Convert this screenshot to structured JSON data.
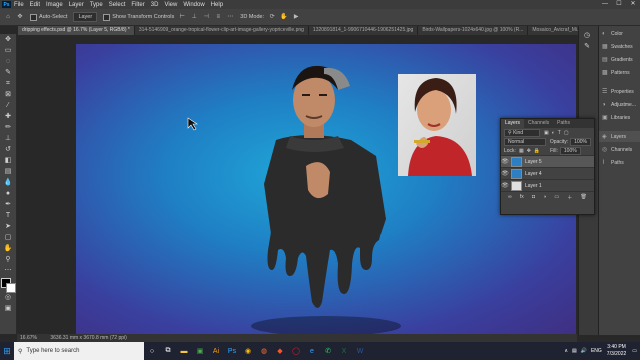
{
  "menubar": {
    "app_logo": "Ps",
    "items": [
      "File",
      "Edit",
      "Image",
      "Layer",
      "Type",
      "Select",
      "Filter",
      "3D",
      "View",
      "Window",
      "Help"
    ],
    "minimize": "—",
    "maximize": "☐",
    "close": "✕"
  },
  "options": {
    "auto_select_label": "Auto-Select",
    "auto_select_target": "Layer",
    "transform_controls_label": "Show Transform Controls",
    "mode_3d_label": "3D Mode:"
  },
  "tabs": [
    {
      "label": "dripping effects.psd @ 16.7% (Layer 5, RGB/8) *",
      "active": true
    },
    {
      "label": "314-5146909_orange-tropical-flower-clip-art-image-gallery-yopriceville.png",
      "active": false
    },
    {
      "label": "1320891814_1-9906710446-1906251425.jpg",
      "active": false
    },
    {
      "label": "Birds-Wallpapers-1024x640.jpg @ 100% (R...",
      "active": false
    },
    {
      "label": "Mosaico_Avicraf_Mi...",
      "active": false
    }
  ],
  "panels": {
    "items": [
      {
        "icon": "color-icon",
        "label": "Color"
      },
      {
        "icon": "swatches-icon",
        "label": "Swatches"
      },
      {
        "icon": "gradients-icon",
        "label": "Gradients"
      },
      {
        "icon": "patterns-icon",
        "label": "Patterns"
      },
      {
        "icon": "properties-icon",
        "label": "Properties"
      },
      {
        "icon": "adjustments-icon",
        "label": "Adjustme..."
      },
      {
        "icon": "libraries-icon",
        "label": "Libraries"
      },
      {
        "icon": "layers-icon",
        "label": "Layers"
      },
      {
        "icon": "channels-icon",
        "label": "Channels"
      },
      {
        "icon": "paths-icon",
        "label": "Paths"
      }
    ]
  },
  "layers_panel": {
    "tabs": [
      "Layers",
      "Channels",
      "Paths"
    ],
    "filter_label": "Kind",
    "blend_mode": "Normal",
    "opacity_label": "Opacity:",
    "opacity_value": "100%",
    "lock_label": "Lock:",
    "fill_label": "Fill:",
    "fill_value": "100%",
    "layers": [
      {
        "name": "Layer 5",
        "selected": true
      },
      {
        "name": "Layer 4",
        "selected": false
      },
      {
        "name": "Layer 1",
        "selected": false
      }
    ]
  },
  "status": {
    "zoom": "16.67%",
    "doc_size": "3636.31 mm x 3670.8 mm (72 ppi)"
  },
  "taskbar": {
    "search_placeholder": "Type here to search",
    "language": "ENG",
    "time": "3:40 PM",
    "date": "7/3/2022"
  },
  "colors": {
    "canvas_center": "#1fa7d8",
    "canvas_edge": "#3f2f82",
    "ui_dark": "#424242",
    "accent": "#31a8ff"
  }
}
